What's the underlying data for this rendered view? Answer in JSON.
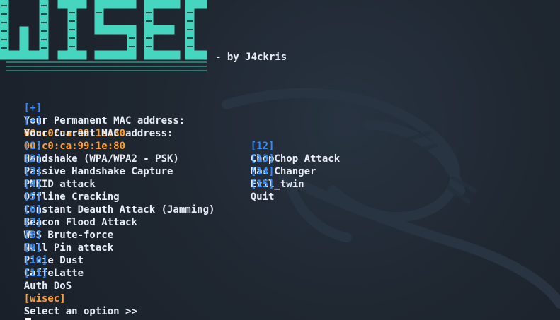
{
  "banner": {
    "logo_text": "WISEC",
    "byline": "- by J4ckris"
  },
  "mac": {
    "permanent": {
      "prefix": "[+]",
      "label": "Your Permanent MAC address:",
      "value": "00:c0:ca:99:1e:80"
    },
    "current": {
      "prefix": "[+]",
      "label": "Your Current MAC address:",
      "value": "00:c0:ca:99:1e:80"
    }
  },
  "menu": {
    "left": [
      {
        "num": "[1]",
        "label": "Handshake (WPA/WPA2 - PSK)"
      },
      {
        "num": "[2]",
        "label": "Passive Handshake Capture"
      },
      {
        "num": "[3]",
        "label": "PMKID attack"
      },
      {
        "num": "[4]",
        "label": "Offline Cracking"
      },
      {
        "num": "[5]",
        "label": "Constant Deauth Attack (Jamming)"
      },
      {
        "num": "[6]",
        "label": "Beacon Flood Attack"
      },
      {
        "num": "[7]",
        "label": "WPS Brute-force"
      },
      {
        "num": "[8]",
        "label": "Null Pin attack"
      },
      {
        "num": "[9]",
        "label": "Pixie Dust"
      },
      {
        "num": "[10]",
        "label": "CaffeLatte"
      },
      {
        "num": "[11]",
        "label": "Auth DoS"
      }
    ],
    "right": [
      {
        "num": "[12]",
        "label": "ChopChop Attack"
      },
      {
        "num": "[13]",
        "label": "Mac Changer"
      },
      {
        "num": "[14]",
        "label": "Evil_twin"
      },
      {
        "num": "[15]",
        "label": "Quit"
      }
    ]
  },
  "prompt": {
    "tag": "[wisec]",
    "text": "Select an option >>"
  },
  "colors": {
    "logo": "#46d6bf",
    "blue": "#2f8cff",
    "orange": "#ff9f2e",
    "text": "#e8edf5",
    "background": "#1f2731"
  }
}
